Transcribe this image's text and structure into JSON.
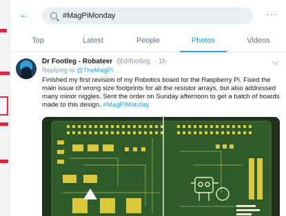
{
  "search": {
    "query": "#MagPiMonday"
  },
  "tabs": [
    "Top",
    "Latest",
    "People",
    "Photos",
    "Videos"
  ],
  "active_tab": "Photos",
  "tweet": {
    "name": "Dr Footleg - Robateer",
    "handle": "@drfootleg",
    "time": "· 1h",
    "replying_prefix": "Replying to ",
    "replying_to": "@TheMagPi",
    "text": "Finished my first revision of my Robotics board for the Raspberry Pi. Fixed the main issue of wrong size footprints for all the resistor arrays, but also addressed many minor niggles. Sent the order on Sunday afternoon to get a batch of boards made to this design.",
    "hashtag": "#MagPiMonday"
  },
  "icons": {
    "back": "back-arrow-icon",
    "search": "search-icon",
    "more": "more-dots-icon",
    "menu": "chevron-down-icon"
  },
  "colors": {
    "accent": "#1da1f2",
    "marker": "#e0283e",
    "pcb": "#2f5a2a"
  }
}
